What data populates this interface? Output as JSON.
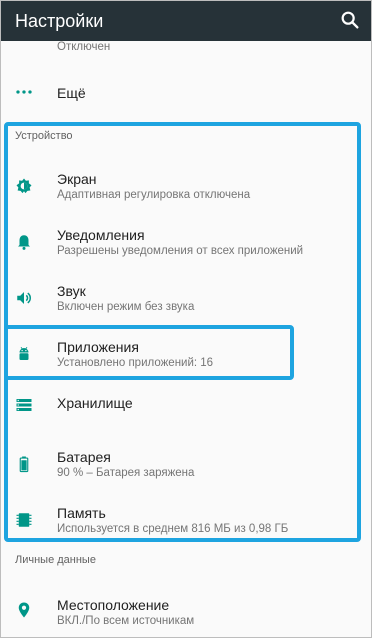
{
  "appbar": {
    "title": "Настройки"
  },
  "top_partial": {
    "subtitle": "Отключен"
  },
  "more_item": {
    "label": "Ещё"
  },
  "device_section": {
    "title": "Устройство",
    "items": [
      {
        "title": "Экран",
        "subtitle": "Адаптивная регулировка отключена",
        "icon": "brightness-icon"
      },
      {
        "title": "Уведомления",
        "subtitle": "Разрешены уведомления от всех приложений",
        "icon": "bell-icon"
      },
      {
        "title": "Звук",
        "subtitle": "Включен режим без звука",
        "icon": "volume-icon"
      },
      {
        "title": "Приложения",
        "subtitle": "Установлено приложений: 16",
        "icon": "android-icon"
      },
      {
        "title": "Хранилище",
        "subtitle": "",
        "icon": "storage-icon"
      },
      {
        "title": "Батарея",
        "subtitle": "90 % – Батарея заряжена",
        "icon": "battery-icon"
      },
      {
        "title": "Память",
        "subtitle": "Используется в среднем 816 МБ из 0,98 ГБ",
        "icon": "memory-icon"
      }
    ]
  },
  "personal_section": {
    "title": "Личные данные",
    "items": [
      {
        "title": "Местоположение",
        "subtitle": "ВКЛ./По всем источникам",
        "icon": "location-icon"
      }
    ]
  },
  "colors": {
    "appbar": "#263238",
    "icon_accent": "#009688",
    "highlight": "#1ea4e0"
  }
}
